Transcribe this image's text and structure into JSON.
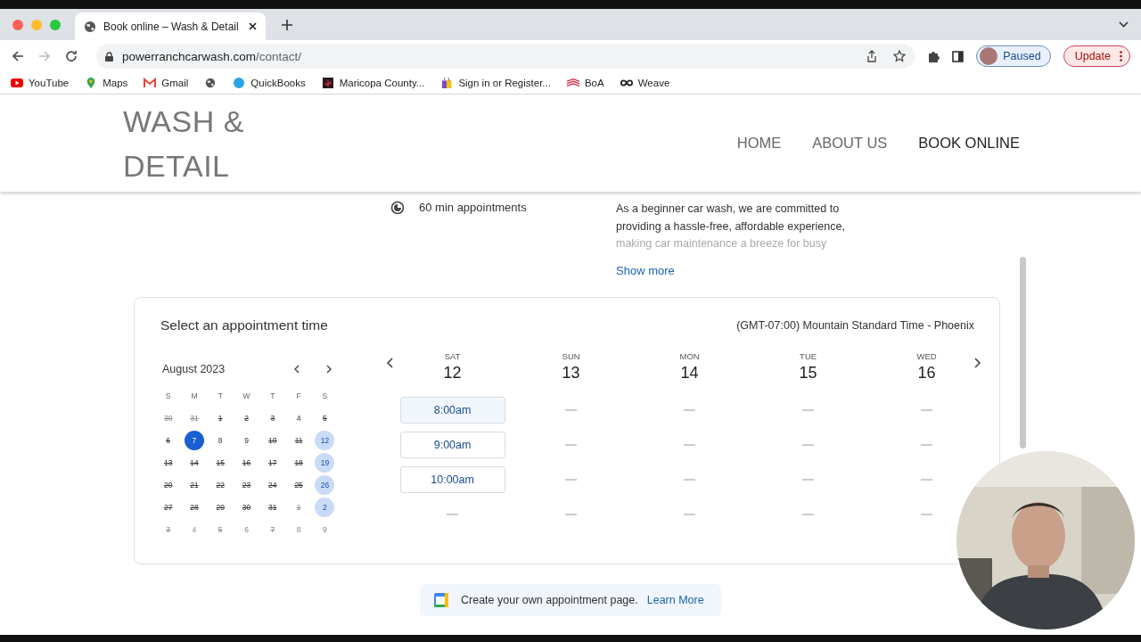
{
  "browser": {
    "tab_title": "Book online – Wash & Detail",
    "url_host": "powerranchcarwash.com",
    "url_path": "/contact/",
    "profile_label": "Paused",
    "update_label": "Update",
    "bookmarks": [
      {
        "label": "YouTube",
        "kind": "youtube"
      },
      {
        "label": "Maps",
        "kind": "maps"
      },
      {
        "label": "Gmail",
        "kind": "gmail"
      },
      {
        "kind": "globe"
      },
      {
        "label": "QuickBooks",
        "kind": "circle"
      },
      {
        "label": "Maricopa County...",
        "kind": "square"
      },
      {
        "label": "Sign in or Register...",
        "kind": "bag"
      },
      {
        "label": "BoA",
        "kind": "flag"
      },
      {
        "label": "Weave",
        "kind": "loop"
      }
    ]
  },
  "site": {
    "logo_lines": [
      "WASH &",
      "DETAIL"
    ],
    "nav": [
      {
        "label": "HOME",
        "selected": false
      },
      {
        "label": "ABOUT US",
        "selected": false
      },
      {
        "label": "BOOK ONLINE",
        "selected": true
      }
    ]
  },
  "service": {
    "duration": "60 min appointments",
    "description_lines": [
      "As a beginner car wash, we are committed to",
      "providing a hassle-free, affordable experience,",
      "making car maintenance a breeze for busy"
    ],
    "show_more": "Show more"
  },
  "booking": {
    "title": "Select an appointment time",
    "timezone": "(GMT-07:00) Mountain Standard Time - Phoenix",
    "month": "August 2023",
    "weekday_letters": [
      "S",
      "M",
      "T",
      "W",
      "T",
      "F",
      "S"
    ],
    "weeks": [
      [
        {
          "day": "30",
          "outside": true,
          "struck": true
        },
        {
          "day": "31",
          "outside": true,
          "struck": true
        },
        {
          "day": "1",
          "struck": true
        },
        {
          "day": "2",
          "struck": true
        },
        {
          "day": "3",
          "struck": true
        },
        {
          "day": "4"
        },
        {
          "day": "5",
          "struck": true
        }
      ],
      [
        {
          "day": "6",
          "struck": true
        },
        {
          "day": "7",
          "today": true
        },
        {
          "day": "8"
        },
        {
          "day": "9"
        },
        {
          "day": "10",
          "struck": true
        },
        {
          "day": "11",
          "struck": true
        },
        {
          "day": "12",
          "available": true
        }
      ],
      [
        {
          "day": "13",
          "struck": true
        },
        {
          "day": "14",
          "struck": true
        },
        {
          "day": "15",
          "struck": true
        },
        {
          "day": "16",
          "struck": true
        },
        {
          "day": "17",
          "struck": true
        },
        {
          "day": "18",
          "struck": true
        },
        {
          "day": "19",
          "available": true
        }
      ],
      [
        {
          "day": "20",
          "struck": true
        },
        {
          "day": "21",
          "struck": true
        },
        {
          "day": "22",
          "struck": true
        },
        {
          "day": "23",
          "struck": true
        },
        {
          "day": "24",
          "struck": true
        },
        {
          "day": "25",
          "struck": true
        },
        {
          "day": "26",
          "available": true
        }
      ],
      [
        {
          "day": "27",
          "struck": true
        },
        {
          "day": "28",
          "struck": true
        },
        {
          "day": "29",
          "struck": true
        },
        {
          "day": "30",
          "struck": true
        },
        {
          "day": "31",
          "struck": true
        },
        {
          "day": "1",
          "outside": true,
          "struck": true
        },
        {
          "day": "2",
          "outside": true,
          "available": true
        }
      ],
      [
        {
          "day": "3",
          "outside": true,
          "struck": true
        },
        {
          "day": "4",
          "outside": true
        },
        {
          "day": "5",
          "outside": true,
          "struck": true
        },
        {
          "day": "6",
          "outside": true
        },
        {
          "day": "7",
          "outside": true,
          "struck": true
        },
        {
          "day": "8",
          "outside": true
        },
        {
          "day": "9",
          "outside": true
        }
      ]
    ],
    "days": [
      {
        "weekday": "SAT",
        "date": "12",
        "slots": [
          {
            "kind": "time",
            "time": "8:00am",
            "hovered": true
          },
          {
            "kind": "time",
            "time": "9:00am",
            "hovered": false
          },
          {
            "kind": "time",
            "time": "10:00am",
            "hovered": false
          },
          {
            "kind": "empty"
          }
        ]
      },
      {
        "weekday": "SUN",
        "date": "13",
        "slots": [
          {
            "kind": "empty"
          },
          {
            "kind": "empty"
          },
          {
            "kind": "empty"
          },
          {
            "kind": "empty"
          }
        ]
      },
      {
        "weekday": "MON",
        "date": "14",
        "slots": [
          {
            "kind": "empty"
          },
          {
            "kind": "empty"
          },
          {
            "kind": "empty"
          },
          {
            "kind": "empty"
          }
        ]
      },
      {
        "weekday": "TUE",
        "date": "15",
        "slots": [
          {
            "kind": "empty"
          },
          {
            "kind": "empty"
          },
          {
            "kind": "empty"
          },
          {
            "kind": "empty"
          }
        ]
      },
      {
        "weekday": "WED",
        "date": "16",
        "slots": [
          {
            "kind": "empty"
          },
          {
            "kind": "empty"
          },
          {
            "kind": "empty"
          },
          {
            "kind": "empty"
          }
        ]
      }
    ]
  },
  "promo": {
    "text": "Create your own appointment page.",
    "link": "Learn More"
  }
}
